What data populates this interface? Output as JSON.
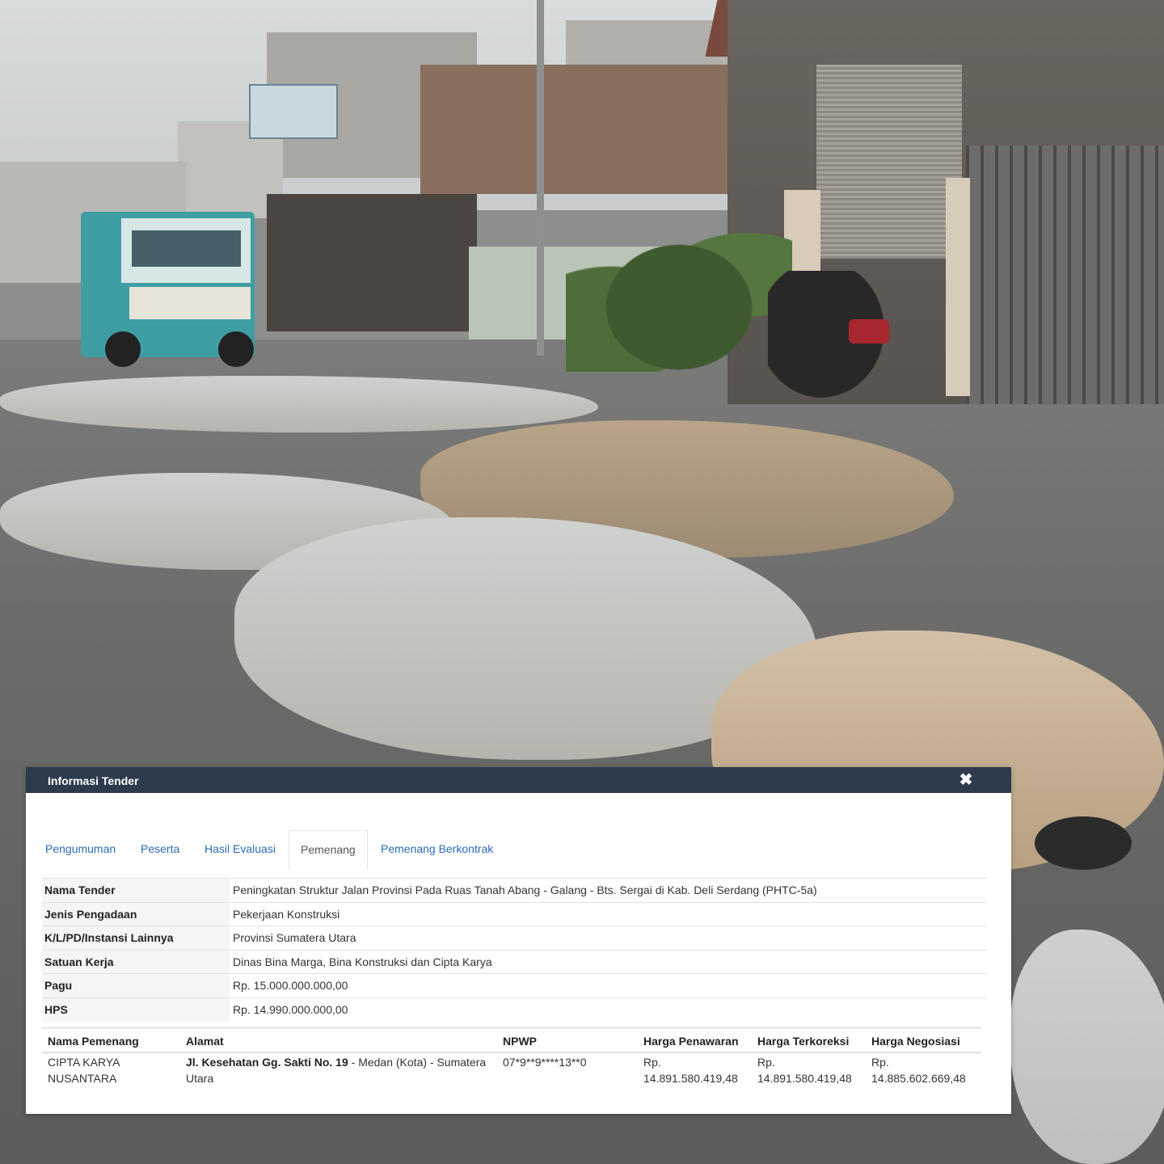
{
  "dialog": {
    "title": "Informasi Tender",
    "close_icon": "close-icon"
  },
  "tabs": [
    "Pengumuman",
    "Peserta",
    "Hasil Evaluasi",
    "Pemenang",
    "Pemenang Berkontrak"
  ],
  "active_tab": "Pemenang",
  "info": [
    {
      "label": "Nama Tender",
      "value": "Peningkatan Struktur Jalan Provinsi Pada Ruas Tanah Abang - Galang - Bts. Sergai di Kab. Deli Serdang (PHTC-5a)"
    },
    {
      "label": "Jenis Pengadaan",
      "value": "Pekerjaan Konstruksi"
    },
    {
      "label": "K/L/PD/Instansi Lainnya",
      "value": "Provinsi Sumatera Utara"
    },
    {
      "label": "Satuan Kerja",
      "value": "Dinas Bina Marga, Bina Konstruksi dan Cipta Karya"
    },
    {
      "label": "Pagu",
      "value": "Rp. 15.000.000.000,00"
    },
    {
      "label": "HPS",
      "value": "Rp. 14.990.000.000,00"
    }
  ],
  "winner_table": {
    "headers": [
      "Nama Pemenang",
      "Alamat",
      "NPWP",
      "Harga Penawaran",
      "Harga Terkoreksi",
      "Harga Negosiasi"
    ],
    "row": {
      "nama_line1": "CIPTA KARYA",
      "nama_line2": "NUSANTARA",
      "alamat_bold": "Jl. Kesehatan Gg. Sakti No. 19",
      "alamat_rest": " - Medan (Kota) - Sumatera",
      "alamat_line2": "Utara",
      "npwp": "07*9**9****13**0",
      "penawaran_line1": "Rp.",
      "penawaran_line2": "14.891.580.419,48",
      "terkoreksi_line1": "Rp.",
      "terkoreksi_line2": "14.891.580.419,48",
      "negosiasi_line1": "Rp.",
      "negosiasi_line2": "14.885.602.669,48"
    }
  },
  "colors": {
    "header_bg": "#2d3b4d",
    "tab_link": "#2a6ab6",
    "label_bg": "#f5f5f5"
  }
}
